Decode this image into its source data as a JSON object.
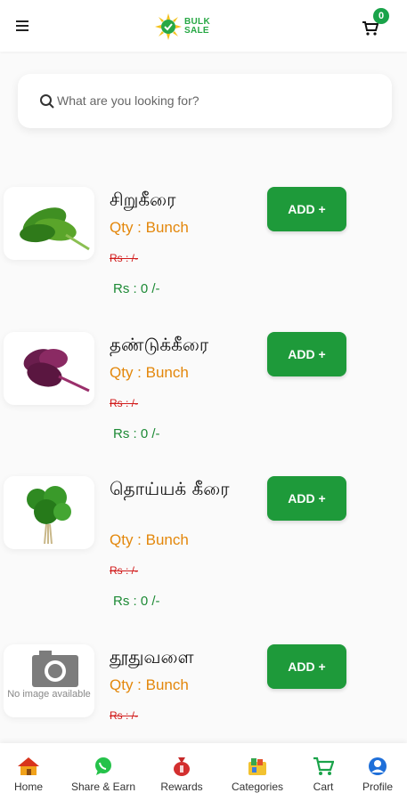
{
  "header": {
    "logo_line1": "BULK",
    "logo_line2": "SALE",
    "cart_count": "0"
  },
  "search": {
    "placeholder": "What are you looking for?"
  },
  "products": [
    {
      "name": "சிறுகீரை",
      "qty": "Qty : Bunch",
      "mrp": "Rs : /-",
      "price": "Rs : 0 /-",
      "add_label": "ADD +",
      "image": "spinach-leaves-image"
    },
    {
      "name": "தண்டுக்கீரை",
      "qty": "Qty : Bunch",
      "mrp": "Rs : /-",
      "price": "Rs : 0 /-",
      "add_label": "ADD +",
      "image": "red-amaranth-image"
    },
    {
      "name": "தொய்யக் கீரை",
      "qty": "Qty : Bunch",
      "mrp": "Rs : /-",
      "price": "Rs : 0 /-",
      "add_label": "ADD +",
      "image": "green-bunch-image"
    },
    {
      "name": "தூதுவளை",
      "qty": "Qty : Bunch",
      "mrp": "Rs : /-",
      "price": "",
      "add_label": "ADD +",
      "image": "camera-icon",
      "image_text": "No image available"
    }
  ],
  "nav": [
    {
      "label": "Home",
      "icon": "home-icon"
    },
    {
      "label": "Share & Earn",
      "icon": "whatsapp-icon"
    },
    {
      "label": "Rewards",
      "icon": "money-bag-icon"
    },
    {
      "label": "Categories",
      "icon": "categories-icon"
    },
    {
      "label": "Cart",
      "icon": "cart-icon"
    },
    {
      "label": "Profile",
      "icon": "profile-icon"
    }
  ],
  "colors": {
    "brand_green": "#1e9a3a",
    "qty_orange": "#e3870b",
    "mrp_red": "#d11b1b",
    "price_green": "#1d8a35"
  }
}
